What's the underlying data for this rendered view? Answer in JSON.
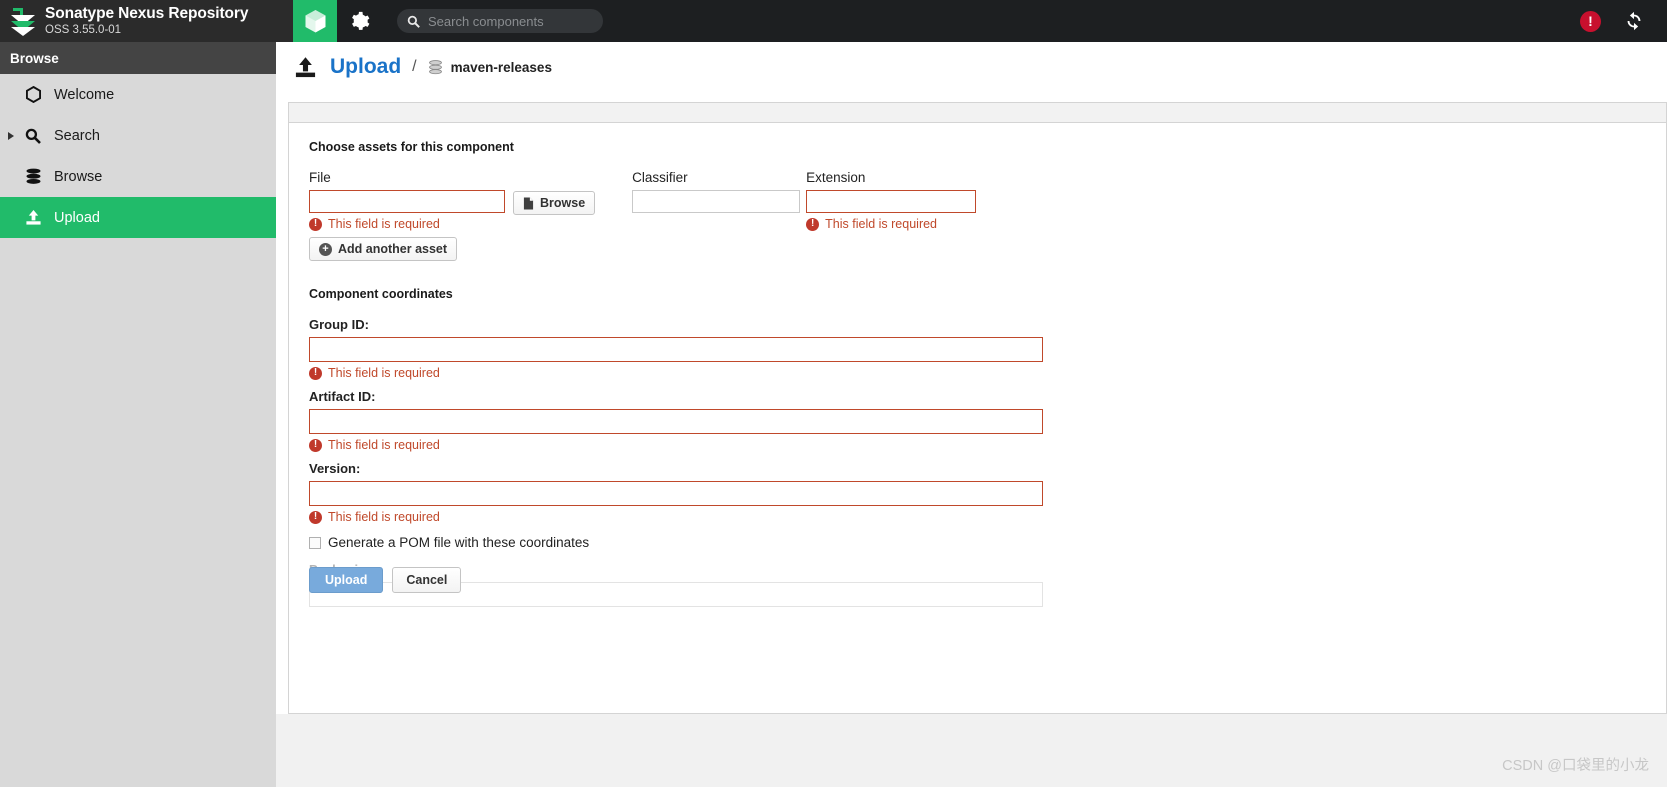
{
  "topbar": {
    "brand_title": "Sonatype Nexus Repository",
    "brand_subtitle": "OSS 3.55.0-01",
    "browse_icon": "cube-icon",
    "settings_icon": "gear-icon",
    "search": {
      "placeholder": "Search components",
      "value": "",
      "icon": "search-icon"
    },
    "error_badge": "!",
    "refresh_icon": "refresh-icon"
  },
  "sidebar": {
    "header": "Browse",
    "items": [
      {
        "label": "Welcome",
        "icon": "hexagon-icon",
        "selected": false,
        "expandable": false
      },
      {
        "label": "Search",
        "icon": "search-icon",
        "selected": false,
        "expandable": true
      },
      {
        "label": "Browse",
        "icon": "database-icon",
        "selected": false,
        "expandable": false
      },
      {
        "label": "Upload",
        "icon": "upload-icon",
        "selected": true,
        "expandable": false
      }
    ]
  },
  "page": {
    "head_icon": "upload-icon",
    "title": "Upload",
    "separator": "/",
    "repo_icon": "database-icon",
    "repo_name": "maven-releases"
  },
  "form": {
    "assets_section_title": "Choose assets for this component",
    "file_label": "File",
    "file_value": "",
    "browse_label": "Browse",
    "browse_icon": "file-icon",
    "classifier_label": "Classifier",
    "classifier_value": "",
    "extension_label": "Extension",
    "extension_value": "",
    "file_error": "This field is required",
    "extension_error": "This field is required",
    "add_asset_label": "Add another asset",
    "add_asset_icon": "plus-circle-icon",
    "coordinates_section_title": "Component coordinates",
    "group_id_label": "Group ID:",
    "group_id_value": "",
    "group_id_error": "This field is required",
    "artifact_id_label": "Artifact ID:",
    "artifact_id_value": "",
    "artifact_id_error": "This field is required",
    "version_label": "Version:",
    "version_value": "",
    "version_error": "This field is required",
    "generate_pom_label": "Generate a POM file with these coordinates",
    "generate_pom_checked": false,
    "packaging_label": "Packaging:",
    "packaging_value": "",
    "upload_label": "Upload",
    "cancel_label": "Cancel"
  },
  "watermark": "CSDN @口袋里的小龙",
  "colors": {
    "accent_green": "#21bb6a",
    "link_blue": "#1a73c8",
    "error_red": "#c0492b",
    "badge_red": "#c8102e",
    "topbar_dark": "#1d1f21",
    "sidebar_grey": "#d9d9d9"
  }
}
